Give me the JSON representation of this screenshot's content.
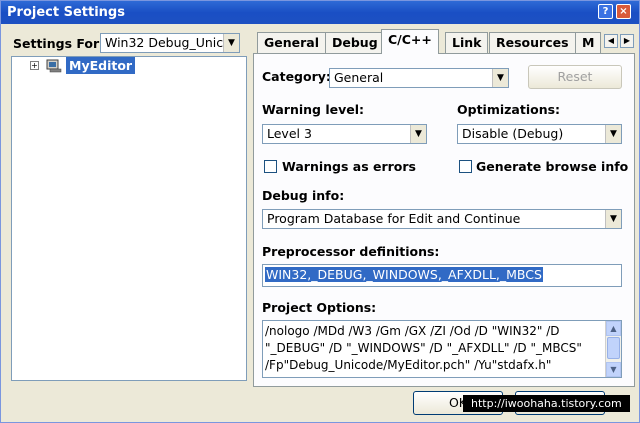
{
  "window": {
    "title": "Project Settings"
  },
  "titlebar": {
    "help_label": "?",
    "close_label": "×"
  },
  "left": {
    "settings_for_label": "Settings For:",
    "settings_for_value": "Win32 Debug_Unic",
    "tree_expander": "+",
    "tree_item": "MyEditor"
  },
  "tabs": [
    {
      "label": "General"
    },
    {
      "label": "Debug"
    },
    {
      "label": "C/C++"
    },
    {
      "label": "Link"
    },
    {
      "label": "Resources"
    },
    {
      "label": "M"
    }
  ],
  "tab_scroll": {
    "left": "◀",
    "right": "▶"
  },
  "page": {
    "category_label": "Category:",
    "category_value": "General",
    "reset_label": "Reset",
    "warning_level_label": "Warning level:",
    "warning_level_value": "Level 3",
    "optimizations_label": "Optimizations:",
    "optimizations_value": "Disable (Debug)",
    "warnings_as_errors_label": "Warnings as errors",
    "generate_browse_info_label": "Generate browse info",
    "debug_info_label": "Debug info:",
    "debug_info_value": "Program Database for Edit and Continue",
    "preprocessor_label": "Preprocessor definitions:",
    "preprocessor_value": "WIN32,_DEBUG,_WINDOWS,_AFXDLL,_MBCS",
    "project_options_label": "Project Options:",
    "project_options_lines": [
      "/nologo /MDd /W3 /Gm /GX /ZI /Od /D \"WIN32\" /D",
      "\"_DEBUG\" /D \"_WINDOWS\" /D \"_AFXDLL\" /D \"_MBCS\"",
      "/Fp\"Debug_Unicode/MyEditor.pch\" /Yu\"stdafx.h\""
    ]
  },
  "bottom": {
    "ok_label": "OK",
    "watermark": "http://iwoohaha.tistory.com"
  }
}
